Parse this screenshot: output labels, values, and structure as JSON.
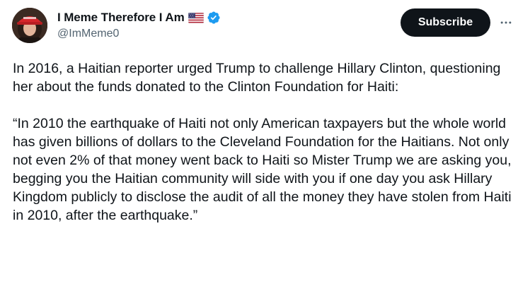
{
  "author": {
    "display_name": "I Meme Therefore I Am",
    "handle": "@ImMeme0",
    "flag_icon": "us-flag-icon",
    "verified_icon": "verified-badge-icon",
    "verified_color": "#1d9bf0"
  },
  "actions": {
    "subscribe_label": "Subscribe",
    "more_icon": "more-horizontal-icon"
  },
  "post": {
    "paragraph_1": "In 2016, a Haitian reporter urged Trump to challenge Hillary Clinton, questioning her about the funds donated to the Clinton Foundation for Haiti:",
    "paragraph_2": "“In 2010 the earthquake of Haiti not only American taxpayers but the whole world has given billions of dollars to the Cleveland Foundation for the Haitians. Not only not even 2% of that money went back to Haiti so Mister Trump we are asking you, begging you the Haitian community will side with you if one day you ask Hillary Kingdom publicly to disclose the audit of all the money they have stolen from Haiti in 2010, after the earthquake.”"
  },
  "colors": {
    "text": "#0f1419",
    "secondary_text": "#536471",
    "button_bg": "#0f1419",
    "button_text": "#ffffff"
  }
}
